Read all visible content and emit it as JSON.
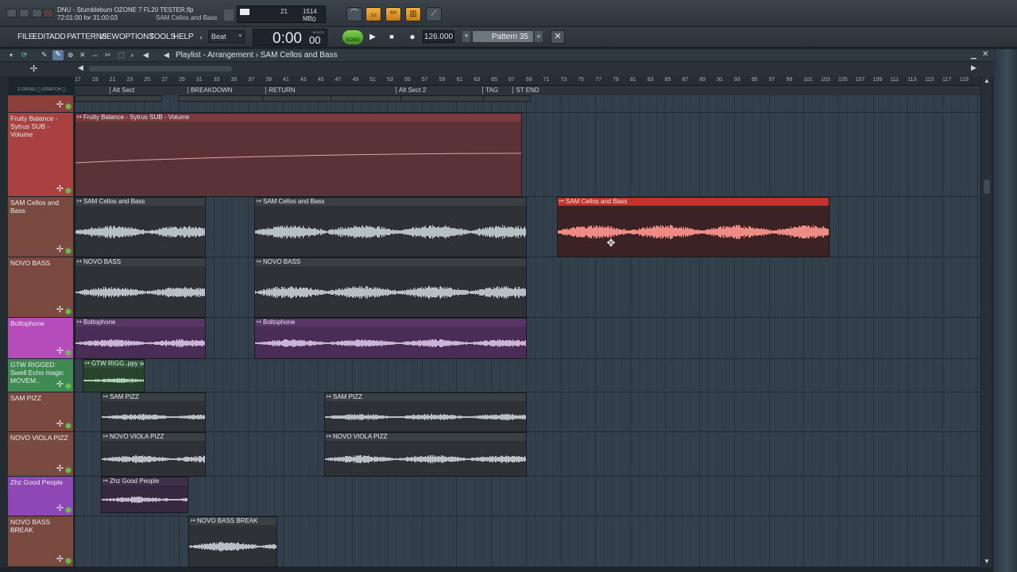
{
  "window": {
    "title": "DNU - Stumblebum OZONE 7 FL20 TESTER.flp",
    "time_info": "72:01:00 for 31:00:03",
    "hint": "SAM Cellos and Bass",
    "cpu": "21",
    "memory": "1514 MB",
    "polyphony": "0"
  },
  "menu": [
    "FILE",
    "EDIT",
    "ADD",
    "PATTERNS",
    "VIEW",
    "OPTIONS",
    "TOOLS",
    "HELP"
  ],
  "transport": {
    "snap": "Beat",
    "time": "0:00",
    "time_sub": "00",
    "time_unit": "M:S:CS",
    "mode": "SONG",
    "tempo": "126.000",
    "pattern": "Pattern 35"
  },
  "playlist": {
    "title": "Playlist - Arrangement",
    "separator": "›",
    "clip_source": "SAM Cellos and Bass",
    "bars": [
      17,
      19,
      21,
      23,
      25,
      27,
      29,
      31,
      33,
      35,
      37,
      39,
      41,
      43,
      45,
      47,
      49,
      51,
      53,
      55,
      57,
      59,
      61,
      63,
      65,
      67,
      69,
      71,
      73,
      75,
      77,
      79,
      81,
      83,
      85,
      87,
      89,
      91,
      93,
      95,
      97,
      99,
      101,
      103,
      105,
      107,
      109,
      111,
      113,
      115,
      117,
      119
    ],
    "markers": [
      "Alt Sect",
      "BREAKDOWN",
      "RETURN",
      "Alt Sect 2",
      "TAG",
      "ST END"
    ]
  },
  "tracks": [
    {
      "name": "",
      "color": "#8c3e3a"
    },
    {
      "name": "Fruity Balance - Sytrus SUB - Volume",
      "color": "#a8413f"
    },
    {
      "name": "SAM Cellos and Bass",
      "color": "#7a4a40"
    },
    {
      "name": "NOVO BASS",
      "color": "#7a4a40"
    },
    {
      "name": "Boltophone",
      "color": "#b54cba"
    },
    {
      "name": "GTW RIGGED Swell Echo magic MOVEM..",
      "color": "#3f8a52"
    },
    {
      "name": "SAM PIZZ",
      "color": "#7a4a40"
    },
    {
      "name": "NOVO VIOLA PIZZ",
      "color": "#7a4a40"
    },
    {
      "name": "Zhz Good People",
      "color": "#8e47b5"
    },
    {
      "name": "NOVO BASS BREAK",
      "color": "#7a4a40"
    }
  ],
  "clips": {
    "automation": "Fruity Balance - Sytrus SUB - Volume",
    "cellos": "SAM Cellos and Bass",
    "novo": "NOVO BASS",
    "bolto": "Boltophone",
    "gtw": "GTW RIGG..ppy soca",
    "pizz": "SAM PIZZ",
    "viola": "NOVO VIOLA PIZZ",
    "zhz": "Zhz Good People",
    "break": "NOVO BASS BREAK"
  },
  "icons": {
    "close": "close-icon",
    "minimize": "minimize-icon",
    "maximize": "maximize-icon",
    "play": "play-icon",
    "stop": "stop-icon",
    "record": "record-icon",
    "move": "move-cursor-icon"
  }
}
